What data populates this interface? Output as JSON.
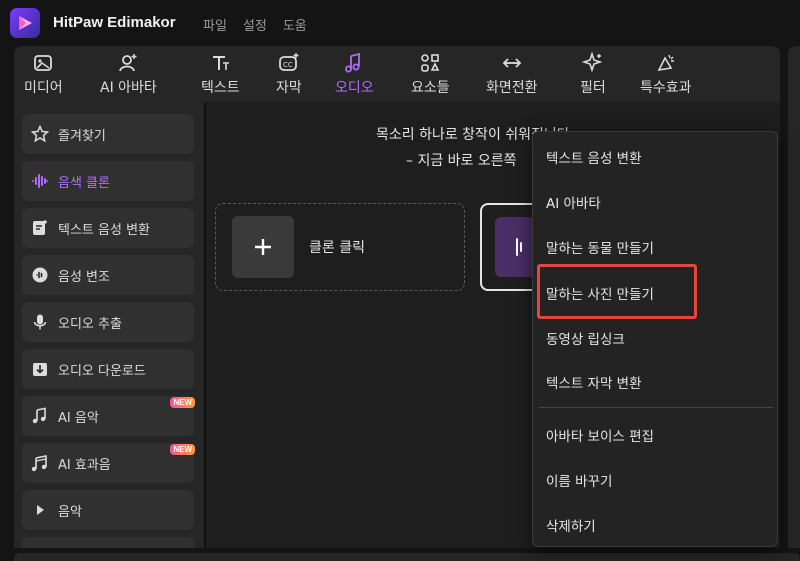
{
  "app": {
    "title": "HitPaw Edimakor",
    "menu": [
      "파일",
      "설정",
      "도움"
    ]
  },
  "toolbar": {
    "tools": [
      {
        "label": "미디어",
        "icon": "media-icon"
      },
      {
        "label": "AI 아바타",
        "icon": "avatar-icon"
      },
      {
        "label": "텍스트",
        "icon": "text-icon"
      },
      {
        "label": "자막",
        "icon": "caption-icon"
      },
      {
        "label": "오디오",
        "icon": "audio-icon",
        "active": true
      },
      {
        "label": "요소들",
        "icon": "elements-icon"
      },
      {
        "label": "화면전환",
        "icon": "transition-icon"
      },
      {
        "label": "필터",
        "icon": "filter-icon"
      },
      {
        "label": "특수효과",
        "icon": "effects-icon"
      }
    ]
  },
  "sidebar": {
    "items": [
      {
        "label": "즐겨찾기",
        "icon": "star-icon"
      },
      {
        "label": "음색 클론",
        "icon": "voice-wave-icon",
        "active": true
      },
      {
        "label": "텍스트 음성 변환",
        "icon": "text-to-speech-icon"
      },
      {
        "label": "음성 변조",
        "icon": "voice-change-icon"
      },
      {
        "label": "오디오 추출",
        "icon": "microphone-icon"
      },
      {
        "label": "오디오 다운로드",
        "icon": "download-icon"
      },
      {
        "label": "AI 음악",
        "icon": "ai-music-icon",
        "badge": "NEW"
      },
      {
        "label": "AI 효과음",
        "icon": "ai-sfx-icon",
        "badge": "NEW"
      },
      {
        "label": "음악",
        "icon": "play-triangle-icon"
      }
    ]
  },
  "main": {
    "hint_line1": "목소리 하나로 창작이 쉬워집니다",
    "hint_line2": "– 지금 바로 오른쪽",
    "clone_card_label": "클론 클릭"
  },
  "context_menu": {
    "items": [
      "텍스트 음성 변환",
      "AI 아바타",
      "말하는 동물 만들기",
      "말하는 사진 만들기",
      "동영상 립싱크",
      "텍스트 자막 변환",
      "아바타 보이스 편집",
      "이름 바꾸기",
      "삭제하기"
    ],
    "highlighted_index": 3
  },
  "colors": {
    "accent": "#b06cff",
    "highlight_border": "#e3473c",
    "badge_gradient_start": "#ff4f9a",
    "badge_gradient_end": "#ff9a3c"
  }
}
